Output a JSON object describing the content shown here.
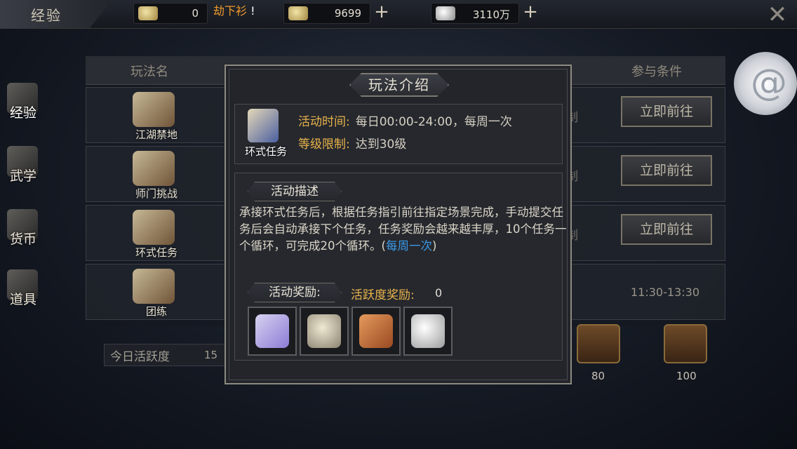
{
  "topbar": {
    "title": "经验",
    "resources": [
      {
        "icon": "gold-ingot-icon",
        "value": "0"
      },
      {
        "icon": "money-bag-icon",
        "value": "9699"
      },
      {
        "icon": "silver-ingot-icon",
        "value": "3110万"
      }
    ],
    "notice_text": "劫下衫",
    "notice_suffix": "!",
    "close_label": "✕"
  },
  "sidebar": [
    {
      "label": "经验",
      "icon": "scroll-icon",
      "active": true
    },
    {
      "label": "武学",
      "icon": "book-icon",
      "active": false
    },
    {
      "label": "货币",
      "icon": "coin-icon",
      "active": false
    },
    {
      "label": "道具",
      "icon": "chest-icon",
      "active": false
    }
  ],
  "table": {
    "headers": {
      "name": "玩法名",
      "condition": "参与条件"
    },
    "rows": [
      {
        "name": "江湖禁地",
        "action": "立即前往",
        "cond": "制"
      },
      {
        "name": "师门挑战",
        "action": "立即前往",
        "cond": "制"
      },
      {
        "name": "环式任务",
        "action": "立即前往",
        "cond": "制"
      },
      {
        "name": "团练",
        "time": "11:30-13:30"
      }
    ]
  },
  "activity": {
    "label": "今日活跃度",
    "value": "15"
  },
  "chests": [
    {
      "value": "80"
    },
    {
      "value": "100"
    }
  ],
  "dialog": {
    "title": "玩法介绍",
    "activity_name": "环式任务",
    "time_label": "活动时间:",
    "time_value": "每日00:00-24:00，每周一次",
    "level_label": "等级限制:",
    "level_value": "达到30级",
    "desc_title": "活动描述",
    "desc_text": "承接环式任务后，根据任务指引前往指定场景完成，手动提交任务后会自动承接下个任务，任务奖励会越来越丰厚，10个任务一个循环，可完成20个循环。(",
    "desc_link": "每周一次",
    "desc_end": ")",
    "reward_title": "活动奖励:",
    "active_reward_label": "活跃度奖励:",
    "active_reward_value": "0",
    "rewards": [
      {
        "icon": "gem-fabric-icon",
        "color": "#8c7bd6"
      },
      {
        "icon": "money-bag-icon",
        "color": "#c9c1a6"
      },
      {
        "icon": "manual-book-icon",
        "color": "#c56a3a"
      },
      {
        "icon": "silver-ingot-icon",
        "color": "#e8e8e8"
      }
    ]
  }
}
